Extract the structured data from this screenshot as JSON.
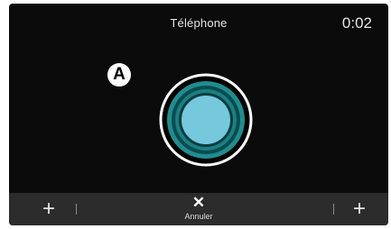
{
  "header": {
    "title": "Téléphone",
    "timer": "0:02"
  },
  "callout": {
    "label": "A"
  },
  "call_button": {
    "icon": "call-circle-icon",
    "colors": {
      "outer_ring": "#ffffff",
      "inner_rings": "#1b8c8e",
      "core": "#73c7dc"
    }
  },
  "bottom_bar": {
    "left_button": {
      "icon": "plus-icon",
      "glyph": "+"
    },
    "cancel": {
      "icon": "close-icon",
      "glyph": "✕",
      "label": "Annuler"
    },
    "right_button": {
      "icon": "plus-icon",
      "glyph": "+"
    }
  }
}
